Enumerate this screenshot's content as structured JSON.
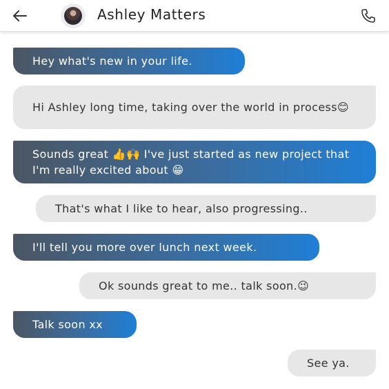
{
  "header": {
    "back_icon": "arrow-left-icon",
    "contact_name": "Ashley Matters",
    "call_icon": "phone-icon"
  },
  "messages": [
    {
      "direction": "sent",
      "text": "Hey what's new in your life."
    },
    {
      "direction": "received",
      "text": "Hi Ashley long time, taking over the world in process😊"
    },
    {
      "direction": "sent",
      "text": "Sounds great 👍🙌 I've just started as new project that I'm really excited about 😁"
    },
    {
      "direction": "received",
      "text": "That's what I like to hear, also progressing.."
    },
    {
      "direction": "sent",
      "text": "I'll tell you more over lunch next week."
    },
    {
      "direction": "received",
      "text": "Ok sounds great to me.. talk soon.😉"
    },
    {
      "direction": "sent",
      "text": "Talk soon xx"
    },
    {
      "direction": "received",
      "text": "See ya."
    }
  ],
  "colors": {
    "sent_gradient_start": "#4b5663",
    "sent_gradient_end": "#1f7fd6",
    "received_bg": "#e7e7e7"
  }
}
